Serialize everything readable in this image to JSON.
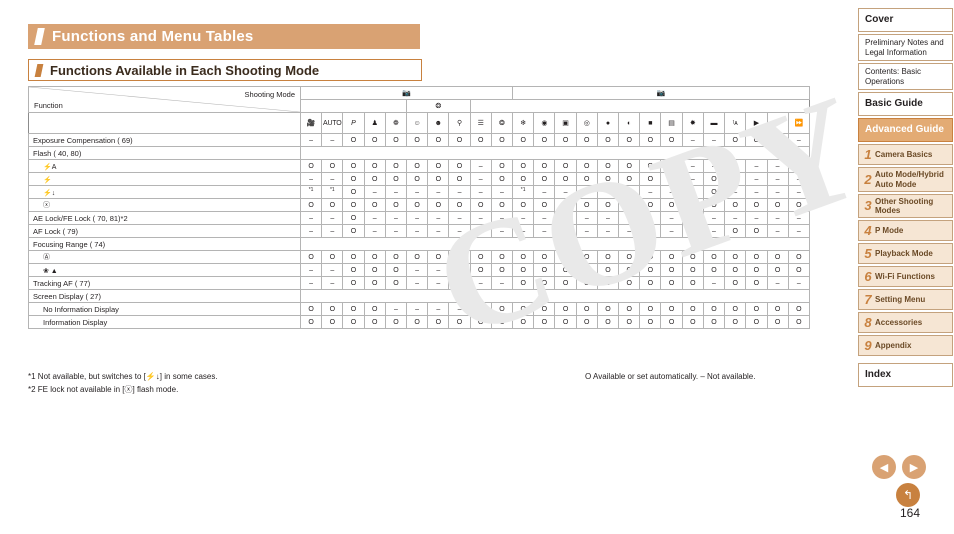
{
  "page": {
    "title": "Functions and Menu Tables",
    "subtitle": "Functions Available in Each Shooting Mode",
    "page_number": "164",
    "watermark": "COPY"
  },
  "table_header": {
    "shooting_mode_label": "Shooting Mode",
    "function_label": "Function",
    "group_icons": [
      "camera-auto-icon",
      "camera-still-icon"
    ],
    "mode_columns": [
      "auto-hybrid-icon",
      "AUTO",
      "P",
      "portrait-icon",
      "smooth-skin-icon",
      "smart-shutter-icon",
      "wink-self-timer-icon",
      "face-self-timer-icon",
      "high-speed-burst-icon",
      "handheld-nightscene-icon",
      "low-light-icon",
      "fisheye-icon",
      "miniature-icon",
      "toy-camera-icon",
      "soft-focus-icon",
      "monochrome-icon",
      "super-vivid-icon",
      "poster-effect-icon",
      "fireworks-icon",
      "long-shutter-icon",
      "movie-icon",
      "movie-std-icon",
      "imovie-icon",
      "super-slow-motion-icon"
    ]
  },
  "rows": [
    {
      "label": "Exposure Compensation ( 69)",
      "indent": 0,
      "cells": [
        "–",
        "–",
        "O",
        "O",
        "O",
        "O",
        "O",
        "O",
        "O",
        "O",
        "O",
        "O",
        "O",
        "O",
        "O",
        "O",
        "O",
        "O",
        "–",
        "–",
        "O",
        "O",
        "–",
        "–"
      ]
    },
    {
      "label": "Flash ( 40, 80)",
      "indent": 0,
      "cells": null
    },
    {
      "label": "flash-auto-icon",
      "indent": 1,
      "icon": "⚡A",
      "cells": [
        "O",
        "O",
        "O",
        "O",
        "O",
        "O",
        "O",
        "O",
        "–",
        "O",
        "O",
        "O",
        "O",
        "O",
        "O",
        "O",
        "O",
        "O",
        "–",
        "–",
        "–",
        "–",
        "–",
        "–"
      ]
    },
    {
      "label": "flash-on-icon",
      "indent": 1,
      "icon": "⚡",
      "cells": [
        "–",
        "–",
        "O",
        "O",
        "O",
        "O",
        "O",
        "O",
        "–",
        "O",
        "O",
        "O",
        "O",
        "O",
        "O",
        "O",
        "O",
        "O",
        "–",
        "O",
        "–",
        "–",
        "–",
        "–"
      ]
    },
    {
      "label": "flash-slow-sync-icon",
      "indent": 1,
      "icon": "⚡↓",
      "cells": [
        "*1",
        "*1",
        "O",
        "–",
        "–",
        "–",
        "–",
        "–",
        "–",
        "–",
        "*1",
        "–",
        "–",
        "–",
        "–",
        "–",
        "–",
        "–",
        "–",
        "O",
        "–",
        "–",
        "–",
        "–"
      ]
    },
    {
      "label": "flash-off-icon",
      "indent": 1,
      "icon": "ⓧ",
      "cells": [
        "O",
        "O",
        "O",
        "O",
        "O",
        "O",
        "O",
        "O",
        "O",
        "O",
        "O",
        "O",
        "O",
        "O",
        "O",
        "O",
        "O",
        "O",
        "O",
        "O",
        "O",
        "O",
        "O",
        "O"
      ]
    },
    {
      "label": "AE Lock/FE Lock ( 70, 81)*2",
      "indent": 0,
      "cells": [
        "–",
        "–",
        "O",
        "–",
        "–",
        "–",
        "–",
        "–",
        "–",
        "–",
        "–",
        "–",
        "–",
        "–",
        "–",
        "–",
        "–",
        "–",
        "–",
        "–",
        "–",
        "–",
        "–",
        "–"
      ]
    },
    {
      "label": "AF Lock ( 79)",
      "indent": 0,
      "cells": [
        "–",
        "–",
        "O",
        "–",
        "–",
        "–",
        "–",
        "–",
        "–",
        "–",
        "–",
        "–",
        "–",
        "–",
        "–",
        "–",
        "–",
        "–",
        "–",
        "–",
        "O",
        "O",
        "–",
        "–"
      ]
    },
    {
      "label": "Focusing Range ( 74)",
      "indent": 0,
      "cells": null
    },
    {
      "label": "normal-af-icon",
      "indent": 1,
      "icon": "Ⓐ",
      "cells": [
        "O",
        "O",
        "O",
        "O",
        "O",
        "O",
        "O",
        "O",
        "O",
        "O",
        "O",
        "O",
        "O",
        "O",
        "O",
        "O",
        "O",
        "O",
        "O",
        "O",
        "O",
        "O",
        "O",
        "O"
      ]
    },
    {
      "label": "macro-infinity-icon",
      "indent": 1,
      "icon": "❀ ▲",
      "cells": [
        "–",
        "–",
        "O",
        "O",
        "O",
        "–",
        "–",
        "–",
        "O",
        "O",
        "O",
        "O",
        "O",
        "O",
        "O",
        "O",
        "O",
        "O",
        "O",
        "O",
        "O",
        "O",
        "O",
        "O"
      ]
    },
    {
      "label": "Tracking AF ( 77)",
      "indent": 0,
      "cells": [
        "–",
        "–",
        "O",
        "O",
        "O",
        "–",
        "–",
        "–",
        "–",
        "–",
        "O",
        "O",
        "O",
        "O",
        "O",
        "O",
        "O",
        "O",
        "O",
        "–",
        "O",
        "O",
        "–",
        "–"
      ]
    },
    {
      "label": "Screen Display ( 27)",
      "indent": 0,
      "cells": null
    },
    {
      "label": "No Information Display",
      "indent": 1,
      "cells": [
        "O",
        "O",
        "O",
        "O",
        "–",
        "–",
        "–",
        "–",
        "O",
        "O",
        "O",
        "O",
        "O",
        "O",
        "O",
        "O",
        "O",
        "O",
        "O",
        "O",
        "O",
        "O",
        "O",
        "O"
      ]
    },
    {
      "label": "Information Display",
      "indent": 1,
      "cells": [
        "O",
        "O",
        "O",
        "O",
        "O",
        "O",
        "O",
        "O",
        "O",
        "O",
        "O",
        "O",
        "O",
        "O",
        "O",
        "O",
        "O",
        "O",
        "O",
        "O",
        "O",
        "O",
        "O",
        "O"
      ]
    }
  ],
  "footnotes": {
    "note1": "*1 Not available, but switches to [⚡↓] in some cases.",
    "note2": "*2 FE lock not available in [ⓧ] flash mode.",
    "legend": "O Available or set automatically. – Not available."
  },
  "nav": {
    "top_items": [
      {
        "label": "Cover",
        "style": "big"
      },
      {
        "label": "Preliminary Notes and Legal Information",
        "style": "small"
      },
      {
        "label": "Contents: Basic Operations",
        "style": "small"
      },
      {
        "label": "Basic Guide",
        "style": "big"
      },
      {
        "label": "Advanced Guide",
        "style": "active"
      }
    ],
    "chapters": [
      {
        "num": "1",
        "label": "Camera Basics"
      },
      {
        "num": "2",
        "label": "Auto Mode/Hybrid Auto Mode"
      },
      {
        "num": "3",
        "label": "Other Shooting Modes"
      },
      {
        "num": "4",
        "label": "P Mode"
      },
      {
        "num": "5",
        "label": "Playback Mode"
      },
      {
        "num": "6",
        "label": "Wi-Fi Functions"
      },
      {
        "num": "7",
        "label": "Setting Menu"
      },
      {
        "num": "8",
        "label": "Accessories"
      },
      {
        "num": "9",
        "label": "Appendix"
      }
    ],
    "index": {
      "label": "Index",
      "style": "big"
    }
  },
  "controls": {
    "prev_arrow": "◀",
    "next_arrow": "▶",
    "home_button": "↰"
  }
}
